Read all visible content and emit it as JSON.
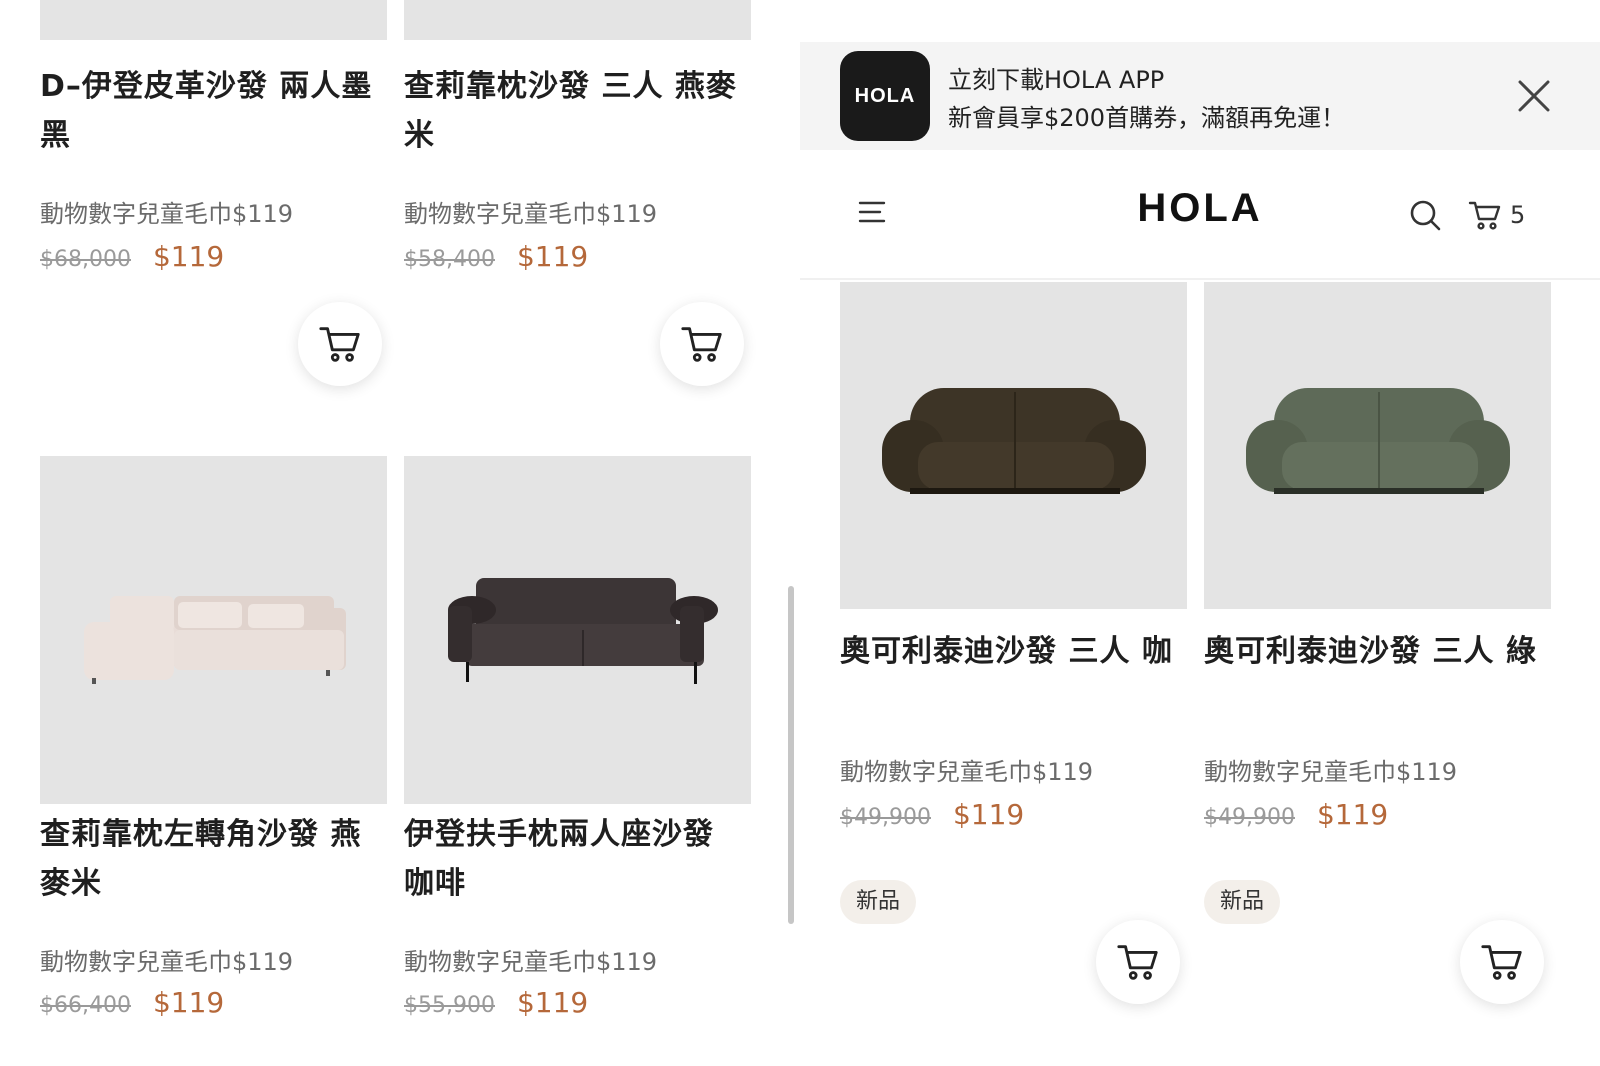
{
  "left_panel": {
    "products": [
      {
        "title": "D–伊登皮革沙發 兩人墨黑",
        "promo": "動物數字兒童毛巾$119",
        "old_price": "$68,000",
        "price": "$119"
      },
      {
        "title": "查莉靠枕沙發 三人 燕麥米",
        "promo": "動物數字兒童毛巾$119",
        "old_price": "$58,400",
        "price": "$119"
      },
      {
        "title": "查莉靠枕左轉角沙發 燕麥米",
        "promo": "動物數字兒童毛巾$119",
        "old_price": "$66,400",
        "price": "$119"
      },
      {
        "title": "伊登扶手枕兩人座沙發 咖啡",
        "promo": "動物數字兒童毛巾$119",
        "old_price": "$55,900",
        "price": "$119"
      }
    ]
  },
  "app_banner": {
    "logo_text": "HOLA",
    "line1": "立刻下載HOLA APP",
    "line2": "新會員享$200首購券，滿額再免運！"
  },
  "header": {
    "brand": "HOLA",
    "cart_count": "5"
  },
  "right_panel": {
    "products": [
      {
        "title": "奧可利泰迪沙發 三人 咖",
        "promo": "動物數字兒童毛巾$119",
        "old_price": "$49,900",
        "price": "$119",
        "badge": "新品",
        "color": "#3d3426"
      },
      {
        "title": "奧可利泰迪沙發 三人 綠",
        "promo": "動物數字兒童毛巾$119",
        "old_price": "$49,900",
        "price": "$119",
        "badge": "新品",
        "color": "#5e6a58"
      }
    ]
  },
  "colors": {
    "sale_price": "#b5683a",
    "image_bg": "#e4e4e4"
  },
  "icons": [
    "cart-icon",
    "close-icon",
    "menu-icon",
    "search-icon"
  ]
}
